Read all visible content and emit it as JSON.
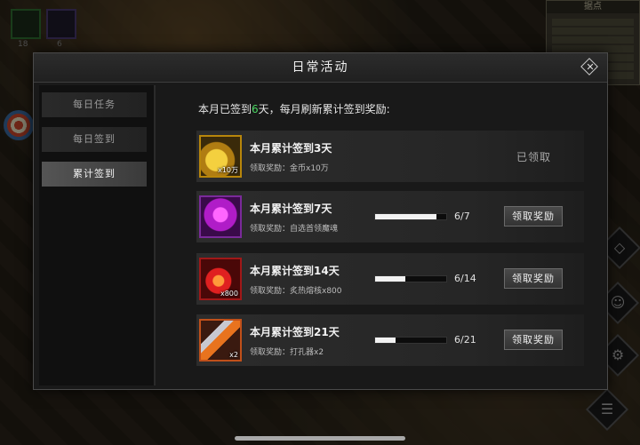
{
  "background": {
    "slots": [
      {
        "count": "18"
      },
      {
        "count": "6"
      }
    ],
    "minimap": {
      "title": "据点"
    }
  },
  "dialog": {
    "title": "日常活动",
    "close_icon": "close-icon"
  },
  "nav": {
    "items": [
      {
        "label": "每日任务",
        "selected": false
      },
      {
        "label": "每日签到",
        "selected": false
      },
      {
        "label": "累计签到",
        "selected": true
      }
    ]
  },
  "summary": {
    "prefix": "本月已签到",
    "days": "6",
    "suffix": "天，每月刷新累计签到奖励:"
  },
  "rewards": [
    {
      "title": "本月累计签到3天",
      "reward_text": "领取奖励：金币x10万",
      "icon": "gold-coins-icon",
      "quantity": "x10万",
      "status": "已领取",
      "progress_text": "",
      "progress": 1.0
    },
    {
      "title": "本月累计签到7天",
      "reward_text": "领取奖励：自选首领魔魂",
      "icon": "boss-soul-icon",
      "quantity": "",
      "status": "",
      "button_label": "领取奖励",
      "progress_text": "6/7",
      "progress": 0.857
    },
    {
      "title": "本月累计签到14天",
      "reward_text": "领取奖励：炙热熔核x800",
      "icon": "fire-core-icon",
      "quantity": "x800",
      "status": "",
      "button_label": "领取奖励",
      "progress_text": "6/14",
      "progress": 0.429
    },
    {
      "title": "本月累计签到21天",
      "reward_text": "领取奖励：打孔器x2",
      "icon": "punch-tool-icon",
      "quantity": "x2",
      "status": "",
      "button_label": "领取奖励",
      "progress_text": "6/21",
      "progress": 0.286
    }
  ],
  "colors": {
    "accent_days": "#4cd964"
  }
}
